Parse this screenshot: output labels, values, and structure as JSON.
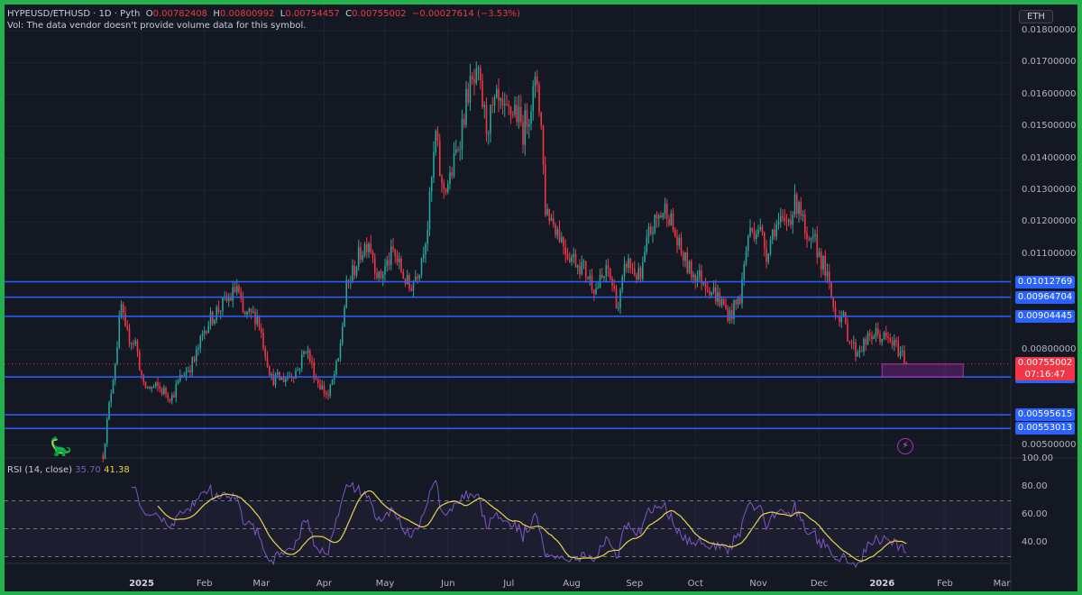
{
  "header": {
    "symbol": "HYPEUSD/ETHUSD · 1D · Pyth",
    "o_label": "O",
    "o": "0.00782408",
    "h_label": "H",
    "h": "0.00800992",
    "l_label": "L",
    "l": "0.00754457",
    "c_label": "C",
    "c": "0.00755002",
    "change": "−0.00027614 (−3.53%)",
    "vol_note": "Vol: The data vendor doesn't provide volume data for this symbol."
  },
  "currency_badge": "ETH",
  "colors": {
    "up": "#26a69a",
    "down": "#f23645",
    "level": "#2962ff",
    "rsi": "#7e57c2",
    "rsi_ma": "#e8d44d",
    "zone": "#b02bb5"
  },
  "chart_data": {
    "type": "candlestick",
    "title": "HYPEUSD/ETHUSD 1D",
    "start_date": "2024-12-01",
    "price_axis": {
      "ylim": [
        0.0048,
        0.0183
      ],
      "ticks": [
        "0.01800000",
        "0.01700000",
        "0.01600000",
        "0.01500000",
        "0.01400000",
        "0.01300000",
        "0.01200000",
        "0.01100000",
        "0.00800000",
        "0.00500000"
      ],
      "tick_values": [
        0.018,
        0.017,
        0.016,
        0.015,
        0.014,
        0.013,
        0.012,
        0.011,
        0.008,
        0.005
      ]
    },
    "time_axis": [
      {
        "label": "2025",
        "day": 31,
        "bold": true
      },
      {
        "label": "Feb",
        "day": 62
      },
      {
        "label": "Mar",
        "day": 90
      },
      {
        "label": "Apr",
        "day": 121
      },
      {
        "label": "May",
        "day": 151
      },
      {
        "label": "Jun",
        "day": 182
      },
      {
        "label": "Jul",
        "day": 212
      },
      {
        "label": "Aug",
        "day": 243
      },
      {
        "label": "Sep",
        "day": 274
      },
      {
        "label": "Oct",
        "day": 304
      },
      {
        "label": "Nov",
        "day": 335
      },
      {
        "label": "Dec",
        "day": 365
      },
      {
        "label": "2026",
        "day": 396,
        "bold": true
      },
      {
        "label": "Feb",
        "day": 427
      },
      {
        "label": "Mar",
        "day": 455
      }
    ],
    "close_anchors_day_price": [
      [
        12,
        0.00469
      ],
      [
        15,
        0.00624
      ],
      [
        18,
        0.00766
      ],
      [
        21,
        0.00935
      ],
      [
        23,
        0.0085
      ],
      [
        28,
        0.00822
      ],
      [
        32,
        0.00681
      ],
      [
        39,
        0.00681
      ],
      [
        46,
        0.00653
      ],
      [
        50,
        0.00709
      ],
      [
        57,
        0.00766
      ],
      [
        63,
        0.00879
      ],
      [
        68,
        0.00921
      ],
      [
        75,
        0.00964
      ],
      [
        78,
        0.00997
      ],
      [
        81,
        0.00907
      ],
      [
        88,
        0.00907
      ],
      [
        95,
        0.00709
      ],
      [
        101,
        0.00709
      ],
      [
        108,
        0.00737
      ],
      [
        112,
        0.00808
      ],
      [
        117,
        0.00709
      ],
      [
        123,
        0.00653
      ],
      [
        128,
        0.00766
      ],
      [
        132,
        0.00992
      ],
      [
        139,
        0.01105
      ],
      [
        143,
        0.01147
      ],
      [
        148,
        0.0102
      ],
      [
        155,
        0.01105
      ],
      [
        159,
        0.01048
      ],
      [
        163,
        0.00992
      ],
      [
        168,
        0.01062
      ],
      [
        172,
        0.0119
      ],
      [
        176,
        0.01472
      ],
      [
        179,
        0.01303
      ],
      [
        183,
        0.01331
      ],
      [
        188,
        0.01472
      ],
      [
        192,
        0.01613
      ],
      [
        197,
        0.01642
      ],
      [
        201,
        0.015
      ],
      [
        206,
        0.01571
      ],
      [
        210,
        0.01529
      ],
      [
        215,
        0.01557
      ],
      [
        219,
        0.01486
      ],
      [
        226,
        0.01642
      ],
      [
        228,
        0.015
      ],
      [
        230,
        0.01246
      ],
      [
        235,
        0.0119
      ],
      [
        241,
        0.01105
      ],
      [
        248,
        0.01062
      ],
      [
        255,
        0.00992
      ],
      [
        261,
        0.01048
      ],
      [
        266,
        0.00935
      ],
      [
        270,
        0.01077
      ],
      [
        277,
        0.0102
      ],
      [
        281,
        0.01161
      ],
      [
        286,
        0.01218
      ],
      [
        290,
        0.01246
      ],
      [
        295,
        0.01133
      ],
      [
        301,
        0.01048
      ],
      [
        308,
        0.0102
      ],
      [
        315,
        0.00964
      ],
      [
        321,
        0.00907
      ],
      [
        326,
        0.00964
      ],
      [
        330,
        0.01161
      ],
      [
        335,
        0.0119
      ],
      [
        339,
        0.01105
      ],
      [
        343,
        0.0119
      ],
      [
        348,
        0.0119
      ],
      [
        355,
        0.01274
      ],
      [
        359,
        0.01118
      ],
      [
        363,
        0.01133
      ],
      [
        368,
        0.01048
      ],
      [
        372,
        0.00935
      ],
      [
        377,
        0.00893
      ],
      [
        379,
        0.0085
      ],
      [
        383,
        0.00794
      ],
      [
        388,
        0.00822
      ],
      [
        392,
        0.0085
      ],
      [
        397,
        0.00836
      ],
      [
        401,
        0.0082
      ],
      [
        406,
        0.00787
      ],
      [
        408,
        0.00755
      ]
    ],
    "levels": [
      "0.01012769",
      "0.00964704",
      "0.00904445",
      "0.00714548",
      "0.00595615",
      "0.00553013"
    ],
    "current_price": "0.00755002",
    "countdown": "07:16:47",
    "zone": {
      "from_day": 396,
      "to_day": 436,
      "top": 0.00755,
      "bottom": 0.00714548
    },
    "rsi": {
      "label": "RSI (14, close)",
      "value": "35.70",
      "ma_value": "41.38",
      "ticks": [
        "100.00",
        "80.00",
        "60.00",
        "40.00"
      ],
      "tick_values": [
        100,
        80,
        60,
        40
      ],
      "bands": [
        70,
        50,
        30
      ]
    }
  }
}
